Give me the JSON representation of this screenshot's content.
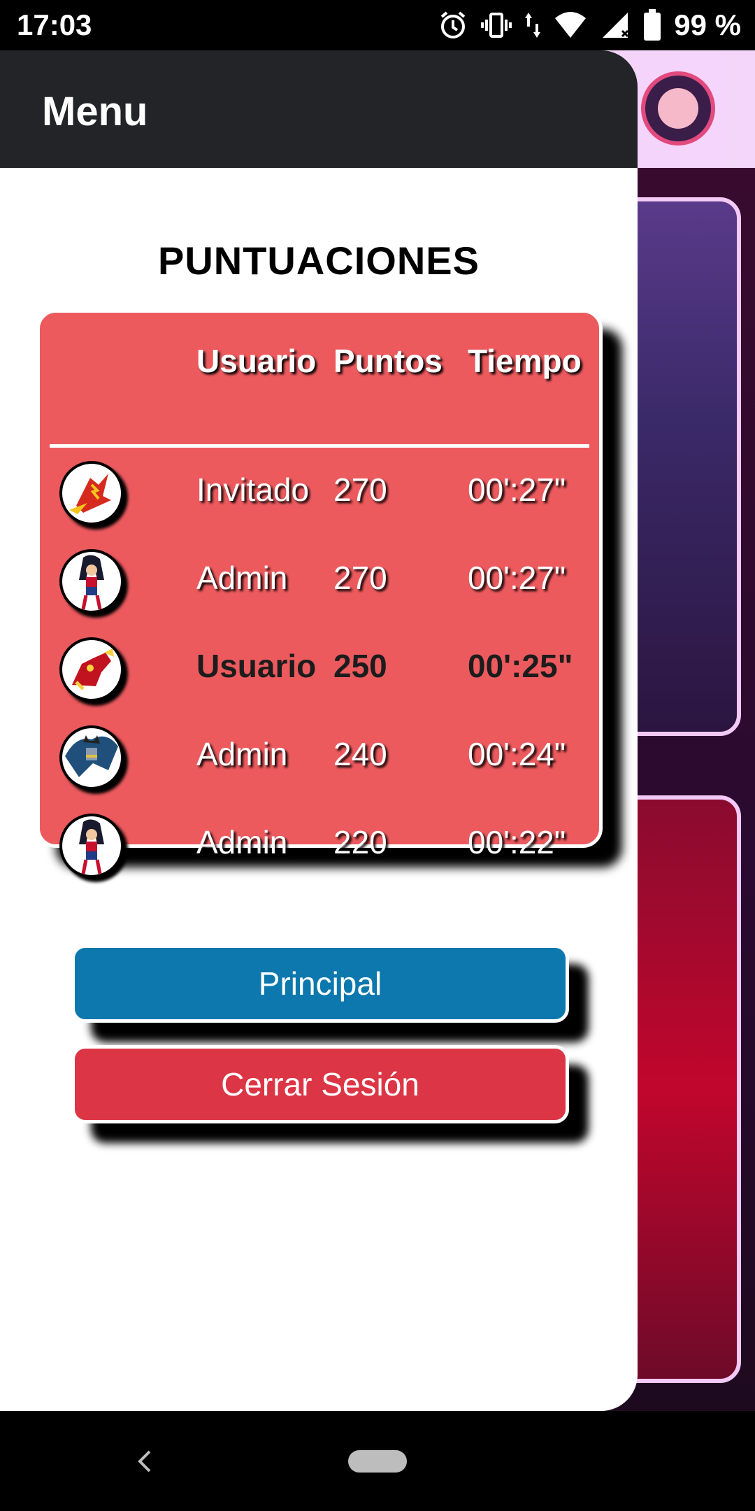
{
  "status_bar": {
    "time": "17:03",
    "battery_text": "99 %",
    "icons": [
      "alarm-icon",
      "vibrate-icon",
      "data-arrows-icon",
      "wifi-icon",
      "signal-icon",
      "battery-icon"
    ]
  },
  "drawer": {
    "title": "Menu"
  },
  "scores": {
    "title": "PUNTUACIONES",
    "headers": {
      "user": "Usuario",
      "points": "Puntos",
      "time": "Tiempo"
    },
    "rows": [
      {
        "avatar": "flash-avatar-icon",
        "user": "Invitado",
        "points": "270",
        "time": "00':27\"",
        "current": false
      },
      {
        "avatar": "wonder-woman-avatar-icon",
        "user": "Admin",
        "points": "270",
        "time": "00':27\"",
        "current": false
      },
      {
        "avatar": "iron-man-avatar-icon",
        "user": "Usuario",
        "points": "250",
        "time": "00':25\"",
        "current": true
      },
      {
        "avatar": "batman-avatar-icon",
        "user": "Admin",
        "points": "240",
        "time": "00':24\"",
        "current": false
      },
      {
        "avatar": "wonder-woman-avatar-icon",
        "user": "Admin",
        "points": "220",
        "time": "00':22\"",
        "current": false
      }
    ]
  },
  "buttons": {
    "principal": "Principal",
    "logout": "Cerrar Sesión"
  },
  "colors": {
    "header_bg": "#232428",
    "card_bg": "#ec5a5e",
    "principal_bg": "#0c78ad",
    "logout_bg": "#dc3545"
  },
  "nav_bar": {
    "icons": [
      "back-icon",
      "home-pill-icon"
    ]
  }
}
